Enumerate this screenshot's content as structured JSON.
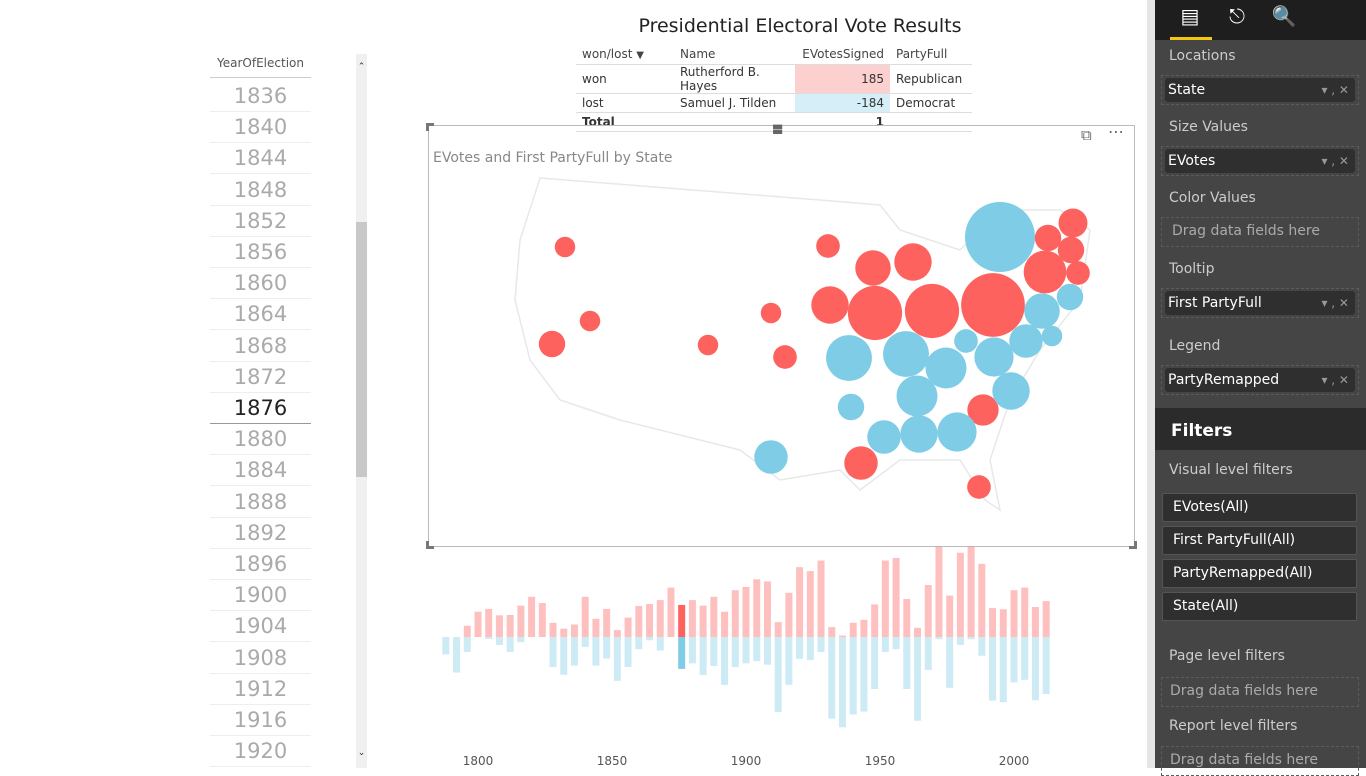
{
  "slicer": {
    "header": "YearOfElection",
    "years": [
      "1836",
      "1840",
      "1844",
      "1848",
      "1852",
      "1856",
      "1860",
      "1864",
      "1868",
      "1872",
      "1876",
      "1880",
      "1884",
      "1888",
      "1892",
      "1896",
      "1900",
      "1904",
      "1908",
      "1912",
      "1916",
      "1920"
    ],
    "selected": "1876"
  },
  "report": {
    "title": "Presidential Electoral Vote Results"
  },
  "table": {
    "columns": [
      "won/lost",
      "Name",
      "EVotesSigned",
      "PartyFull"
    ],
    "rows": [
      {
        "wonlost": "won",
        "name": "Rutherford B. Hayes",
        "evotes": "185",
        "party": "Republican"
      },
      {
        "wonlost": "lost",
        "name": "Samuel J. Tilden",
        "evotes": "-184",
        "party": "Democrat"
      }
    ],
    "total_label": "Total",
    "total": "1"
  },
  "map": {
    "title": "EVotes and First PartyFull by State",
    "colors": {
      "Republican": "#fd625e",
      "Democrat": "#7fcce6"
    },
    "bubbles": [
      {
        "party": "Republican",
        "evotes": 3
      },
      {
        "party": "Republican",
        "evotes": 3
      },
      {
        "party": "Republican",
        "evotes": 5
      },
      {
        "party": "Republican",
        "evotes": 3
      },
      {
        "party": "Republican",
        "evotes": 3
      },
      {
        "party": "Republican",
        "evotes": 4
      },
      {
        "party": "Republican",
        "evotes": 4
      },
      {
        "party": "Republican",
        "evotes": 10
      },
      {
        "party": "Republican",
        "evotes": 9
      },
      {
        "party": "Republican",
        "evotes": 10
      },
      {
        "party": "Republican",
        "evotes": 21
      },
      {
        "party": "Republican",
        "evotes": 21
      },
      {
        "party": "Republican",
        "evotes": 29
      },
      {
        "party": "Republican",
        "evotes": 6
      },
      {
        "party": "Republican",
        "evotes": 5
      },
      {
        "party": "Republican",
        "evotes": 5
      },
      {
        "party": "Republican",
        "evotes": 13
      },
      {
        "party": "Republican",
        "evotes": 4
      },
      {
        "party": "Republican",
        "evotes": 7
      },
      {
        "party": "Republican",
        "evotes": 8
      },
      {
        "party": "Republican",
        "evotes": 4
      },
      {
        "party": "Democrat",
        "evotes": 35
      },
      {
        "party": "Democrat",
        "evotes": 5
      },
      {
        "party": "Democrat",
        "evotes": 9
      },
      {
        "party": "Democrat",
        "evotes": 3
      },
      {
        "party": "Democrat",
        "evotes": 8
      },
      {
        "party": "Democrat",
        "evotes": 4
      },
      {
        "party": "Democrat",
        "evotes": 11
      },
      {
        "party": "Democrat",
        "evotes": 15
      },
      {
        "party": "Democrat",
        "evotes": 15
      },
      {
        "party": "Democrat",
        "evotes": 12
      },
      {
        "party": "Democrat",
        "evotes": 12
      },
      {
        "party": "Democrat",
        "evotes": 10
      },
      {
        "party": "Democrat",
        "evotes": 5
      },
      {
        "party": "Democrat",
        "evotes": 8
      },
      {
        "party": "Democrat",
        "evotes": 10
      },
      {
        "party": "Democrat",
        "evotes": 11
      },
      {
        "party": "Democrat",
        "evotes": 8
      }
    ]
  },
  "chart_data": {
    "type": "bar",
    "xlim": [
      1788,
      2012
    ],
    "x_ticks": [
      "1800",
      "1850",
      "1900",
      "1950",
      "2000"
    ],
    "selected_year": 1876,
    "years": [
      1788,
      1792,
      1796,
      1800,
      1804,
      1808,
      1812,
      1816,
      1820,
      1824,
      1828,
      1832,
      1836,
      1840,
      1844,
      1848,
      1852,
      1856,
      1860,
      1864,
      1868,
      1872,
      1876,
      1880,
      1884,
      1888,
      1892,
      1896,
      1900,
      1904,
      1908,
      1912,
      1916,
      1920,
      1924,
      1928,
      1932,
      1936,
      1940,
      1944,
      1948,
      1952,
      1956,
      1960,
      1964,
      1968,
      1972,
      1976,
      1980,
      1984,
      1988,
      1992,
      1996,
      2000,
      2004,
      2008,
      2012
    ],
    "series": [
      {
        "party": "Republican",
        "color": "#fd625e",
        "values": [
          0,
          0,
          65,
          146,
          162,
          125,
          127,
          181,
          232,
          196,
          82,
          48,
          72,
          232,
          105,
          162,
          40,
          112,
          179,
          190,
          213,
          285,
          185,
          213,
          181,
          232,
          146,
          270,
          289,
          333,
          321,
          86,
          255,
          403,
          380,
          441,
          57,
          8,
          82,
          99,
          188,
          441,
          456,
          219,
          53,
          300,
          521,
          239,
          486,
          521,
          422,
          167,
          160,
          270,
          285,
          173,
          207
        ]
      },
      {
        "party": "Democrat",
        "color": "#7fcce6",
        "values": [
          -101,
          -205,
          -86,
          0,
          -11,
          -46,
          -86,
          -30,
          0,
          0,
          -173,
          -218,
          -165,
          -57,
          -165,
          -124,
          -253,
          -173,
          -70,
          -19,
          -78,
          0,
          -184,
          -152,
          -219,
          -167,
          -276,
          -173,
          -152,
          -139,
          -160,
          -433,
          -276,
          -126,
          -133,
          -86,
          -471,
          -521,
          -447,
          -430,
          -300,
          -86,
          -70,
          -300,
          -483,
          -190,
          -13,
          -293,
          -46,
          -13,
          -108,
          -367,
          -376,
          -262,
          -247,
          -365,
          -329
        ]
      }
    ]
  },
  "panel": {
    "tabs": [
      "fields-icon",
      "format-paint-roller-icon",
      "analytics-magnifier-icon"
    ],
    "wells": [
      {
        "label": "Locations",
        "field": "State"
      },
      {
        "label": "Size Values",
        "field": "EVotes"
      },
      {
        "label": "Color Values",
        "field": "",
        "placeholder": "Drag data fields here"
      },
      {
        "label": "Tooltip",
        "field": "First PartyFull"
      },
      {
        "label": "Legend",
        "field": "PartyRemapped"
      }
    ],
    "filters_title": "Filters",
    "visual_filters_label": "Visual level filters",
    "visual_filters": [
      "EVotes(All)",
      "First PartyFull(All)",
      "PartyRemapped(All)",
      "State(All)"
    ],
    "page_filters_label": "Page level filters",
    "page_placeholder": "Drag data fields here",
    "report_filters_label": "Report level filters",
    "report_placeholder": "Drag data fields here"
  }
}
